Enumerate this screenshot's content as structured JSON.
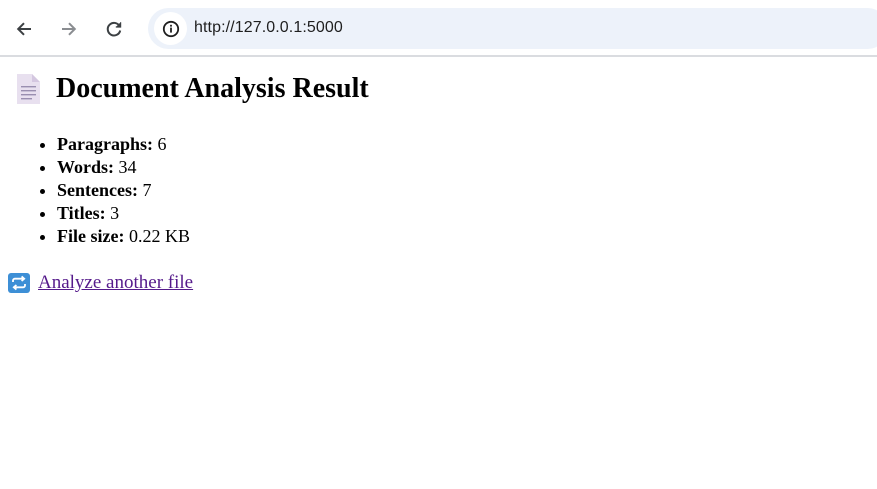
{
  "browser": {
    "url": "http://127.0.0.1:5000",
    "icons": {
      "back": "arrow-left-icon",
      "forward": "arrow-right-icon",
      "reload": "reload-icon",
      "site_info": "info-icon"
    }
  },
  "page": {
    "title": "Document Analysis Result",
    "title_icon": "document-icon",
    "stats": [
      {
        "label": "Paragraphs:",
        "value": "6"
      },
      {
        "label": "Words:",
        "value": "34"
      },
      {
        "label": "Sentences:",
        "value": "7"
      },
      {
        "label": "Titles:",
        "value": "3"
      },
      {
        "label": "File size:",
        "value": "0.22 KB"
      }
    ],
    "again_link": {
      "label": "Analyze another file",
      "icon": "repeat-icon"
    }
  },
  "colors": {
    "link_visited": "#551a8b",
    "omnibox_bg": "#edf2fa",
    "repeat_icon_bg": "#3d8fd6"
  }
}
